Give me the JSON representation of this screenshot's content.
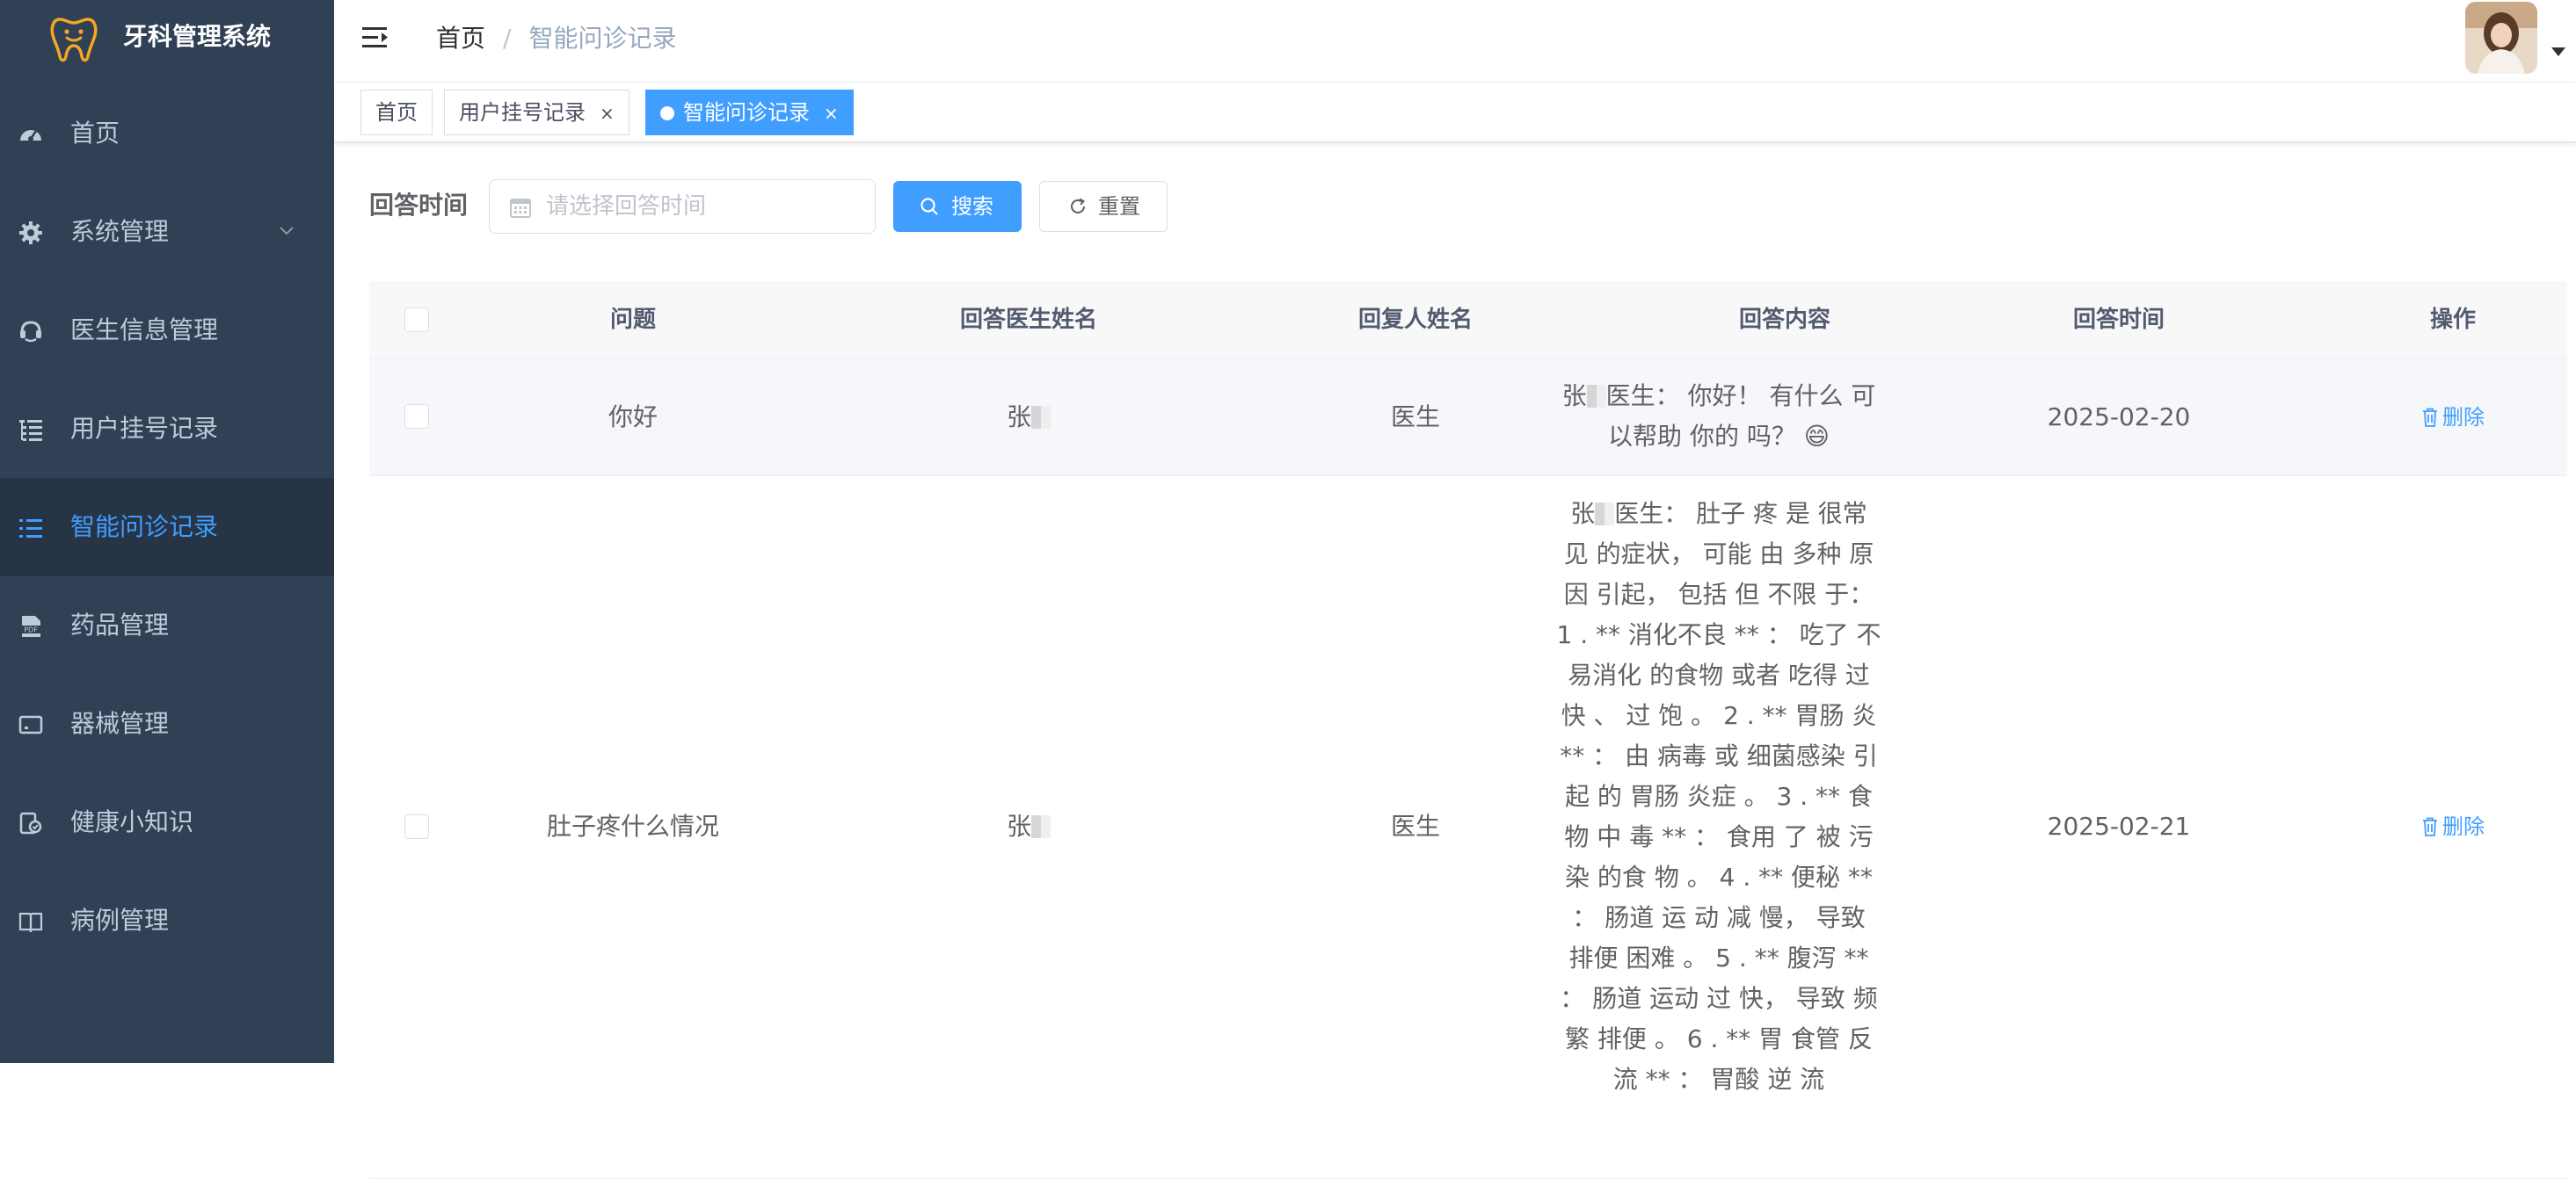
{
  "app": {
    "title": "牙科管理系统"
  },
  "sidebar": {
    "items": [
      {
        "label": "首页",
        "icon": "dashboard-icon"
      },
      {
        "label": "系统管理",
        "icon": "gear-icon"
      },
      {
        "label": "医生信息管理",
        "icon": "doctor-icon"
      },
      {
        "label": "用户挂号记录",
        "icon": "tree-table-icon"
      },
      {
        "label": "智能问诊记录",
        "icon": "list-icon",
        "active": true
      },
      {
        "label": "药品管理",
        "icon": "pdf-icon"
      },
      {
        "label": "器械管理",
        "icon": "monitor-icon"
      },
      {
        "label": "健康小知识",
        "icon": "education-icon"
      },
      {
        "label": "病例管理",
        "icon": "book-icon"
      }
    ]
  },
  "navbar": {
    "breadcrumb": [
      "首页",
      "智能问诊记录"
    ]
  },
  "tags": [
    {
      "label": "首页"
    },
    {
      "label": "用户挂号记录",
      "close": "×"
    },
    {
      "label": "智能问诊记录",
      "close": "×",
      "active": true
    }
  ],
  "search": {
    "label": "回答时间",
    "placeholder": "请选择回答时间",
    "search_label": "搜索",
    "reset_label": "重置"
  },
  "table": {
    "columns": [
      "问题",
      "回答医生姓名",
      "回复人姓名",
      "回答内容",
      "回答时间",
      "操作"
    ],
    "rows": [
      {
        "question": "你好",
        "doctor": "张",
        "replier": "医生",
        "content_prefix": "张",
        "content": "医生： 你好！ 有什么 可以帮助 你的 吗？ 😄",
        "time": "2025-02-20",
        "action": "删除"
      },
      {
        "question": "肚子疼什么情况",
        "doctor": "张",
        "replier": "医生",
        "content_prefix": "张",
        "content": "医生： 肚子 疼 是 很常 见 的症状， 可能 由 多种 原 因 引起， 包括 但 不限 于： 1 . ** 消化不良 ** ： 吃了 不 易消化 的食物 或者 吃得 过 快 、 过 饱 。 2 . ** 胃肠 炎 ** ： 由 病毒 或 细菌感染 引起 的 胃肠 炎症 。 3 . ** 食物 中 毒 ** ： 食用 了 被 污染 的食 物 。 4 . ** 便秘 ** ： 肠道 运 动 减 慢， 导致 排便 困难 。 5 . ** 腹泻 ** ： 肠道 运动 过 快， 导致 频繁 排便 。 6 . ** 胃 食管 反 流 ** ： 胃酸 逆 流",
        "time": "2025-02-21",
        "action": "删除"
      }
    ]
  },
  "colors": {
    "sidebar_bg": "#304156",
    "accent": "#409eff",
    "logo": "#f5a623"
  }
}
